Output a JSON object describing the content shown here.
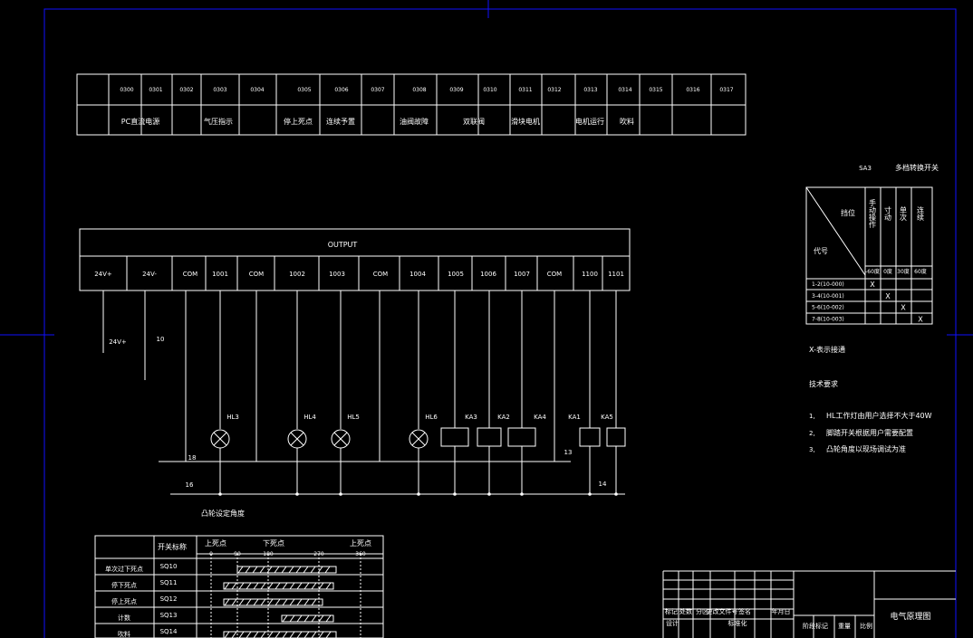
{
  "io_table": {
    "addresses": [
      "0300",
      "0301",
      "0302",
      "0303",
      "0304",
      "0305",
      "0306",
      "0307",
      "0308",
      "0309",
      "0310",
      "0311",
      "0312",
      "0313",
      "0314",
      "0315",
      "0316",
      "0317"
    ],
    "functions": [
      "PC直流电源",
      "气压指示",
      "停上死点",
      "连续予置",
      "油阀故障",
      "双联阀",
      "滑块电机",
      "电机运行",
      "吹料"
    ]
  },
  "output_header": {
    "title": "OUTPUT",
    "terminals": [
      "24V+",
      "24V-",
      "COM",
      "1001",
      "COM",
      "1002",
      "1003",
      "COM",
      "1004",
      "1005",
      "1006",
      "1007",
      "COM",
      "1100",
      "1101"
    ]
  },
  "left_labels": {
    "v24": "24V+",
    "n10": "10"
  },
  "devices": {
    "lamps": [
      "HL3",
      "HL4",
      "HL5",
      "HL6"
    ],
    "relays": [
      "KA3",
      "KA2",
      "KA4",
      "KA1",
      "KA5"
    ]
  },
  "wire_labels": {
    "w18": "18",
    "w16": "16",
    "w13": "13",
    "w14": "14"
  },
  "cam_title": "凸轮设定角度",
  "cam_table": {
    "col_header": "开关标称",
    "positions": [
      "上死点",
      "下死点",
      "上死点"
    ],
    "angles": [
      "0",
      "90",
      "180",
      "270",
      "360"
    ],
    "rows": [
      {
        "name": "单次过下死点",
        "code": "SQ10"
      },
      {
        "name": "停下死点",
        "code": "SQ11"
      },
      {
        "name": "停上死点",
        "code": "SQ12"
      },
      {
        "name": "计数",
        "code": "SQ13"
      },
      {
        "name": "吹料",
        "code": "SQ14"
      }
    ]
  },
  "selector": {
    "code": "SA3",
    "title": "多档转换开关",
    "diag_top": "挡位",
    "diag_bottom": "代号",
    "modes": [
      "手动操作",
      "寸动",
      "单次",
      "连续"
    ],
    "angles": [
      "-60度",
      "0度",
      "30度",
      "60度"
    ],
    "rows": [
      "1-2(10-000)",
      "3-4(10-001)",
      "5-6(10-002)",
      "7-8(10-003)"
    ],
    "marks": [
      "X",
      "X",
      "X",
      "X"
    ]
  },
  "legend_note": "X-表示接通",
  "tech": {
    "title": "技术要求",
    "items": [
      {
        "num": "1,",
        "text": "HL工作灯由用户选择不大于40W"
      },
      {
        "num": "2,",
        "text": "脚踏开关根据用户需要配置"
      },
      {
        "num": "3,",
        "text": "凸轮角度以现场调试为准"
      }
    ]
  },
  "title_block": {
    "headers": [
      "标记",
      "处数",
      "分区",
      "更改文件号",
      "签名",
      "年月日"
    ],
    "design": "设计",
    "standard": "标准化",
    "stage": "阶段标记",
    "weight": "重量",
    "scale": "比例",
    "drawing_title": "电气原理图"
  }
}
